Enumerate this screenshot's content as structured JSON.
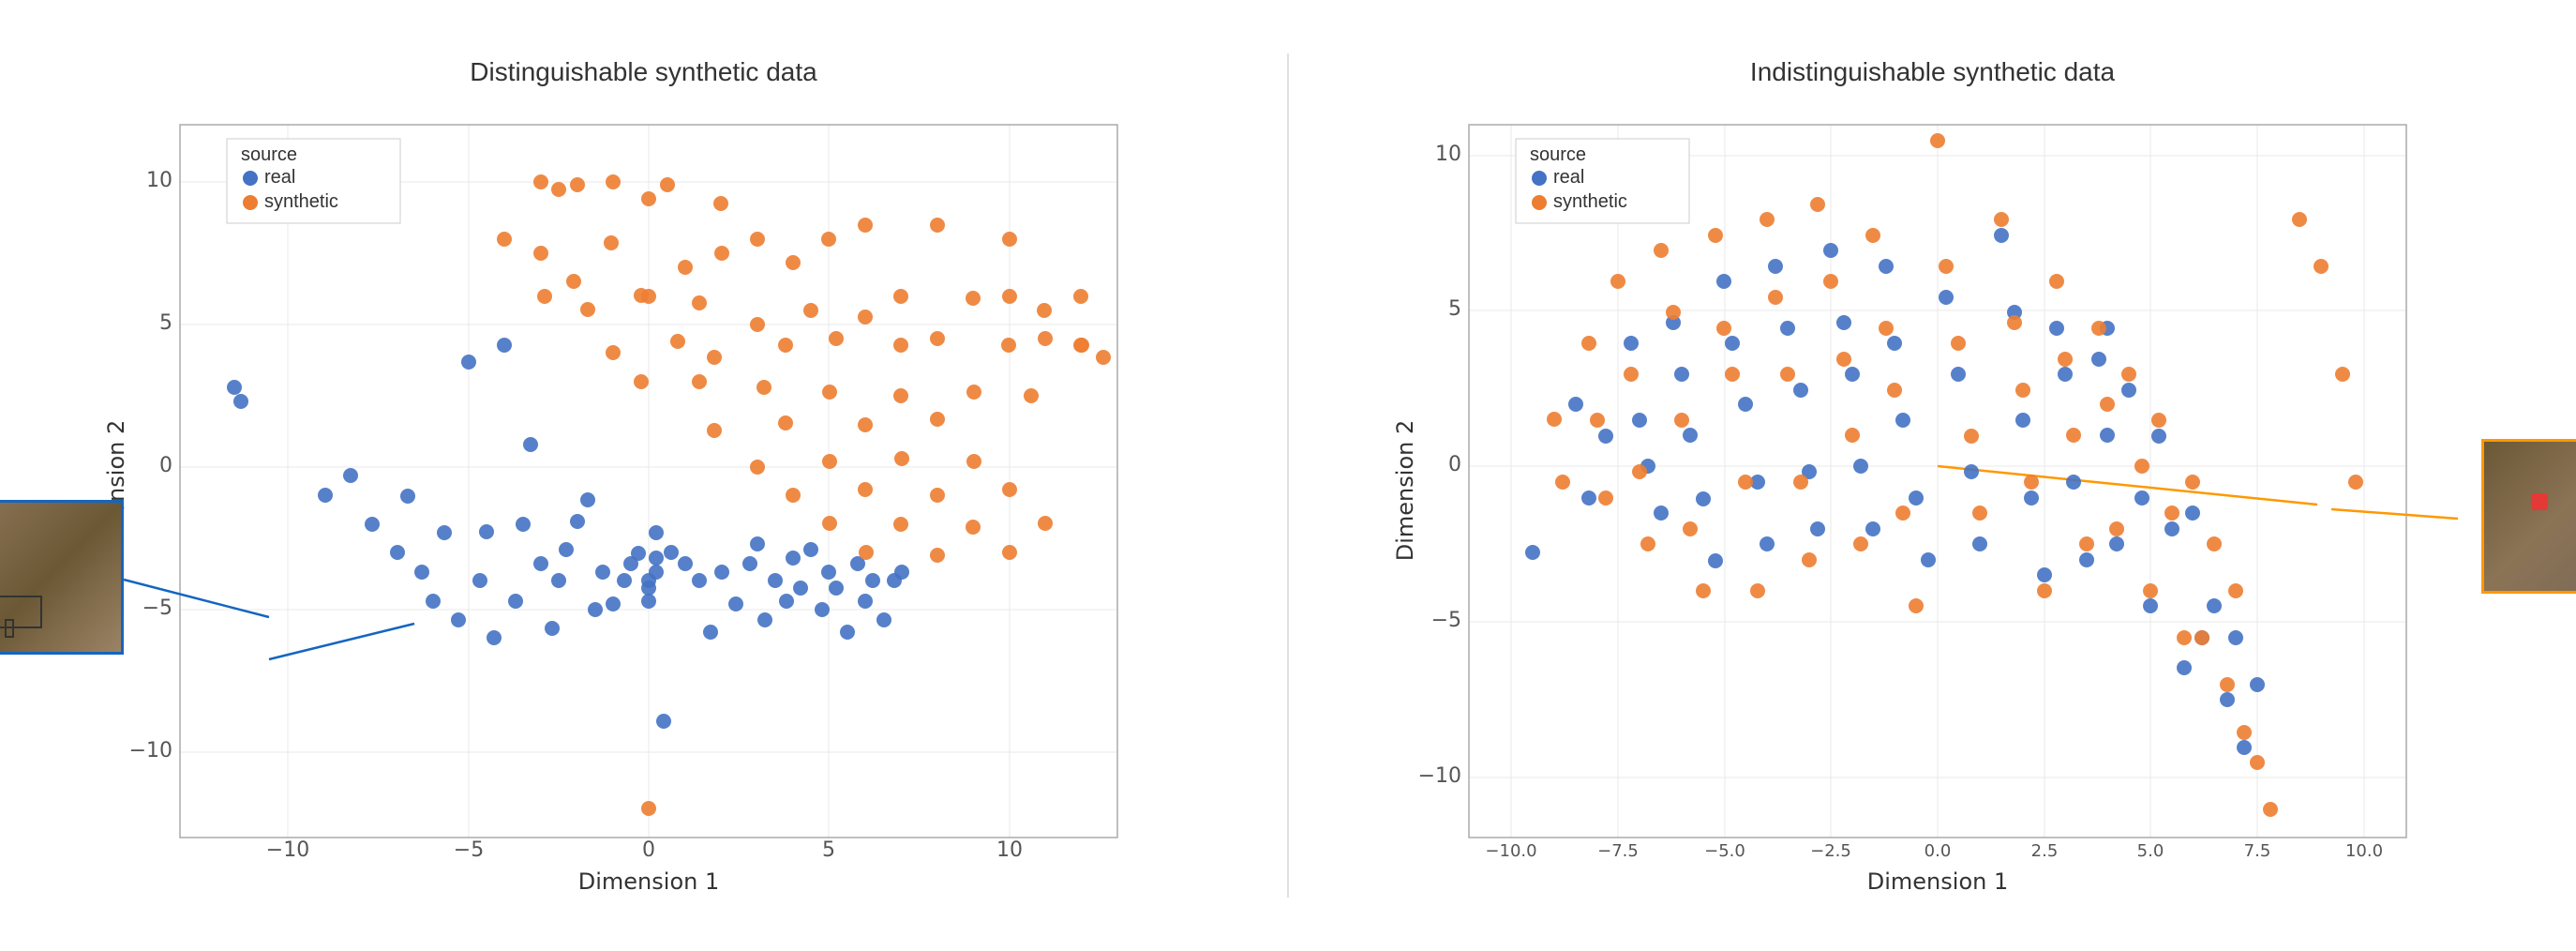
{
  "left_chart": {
    "title": "Distinguishable synthetic data",
    "x_label": "Dimension 1",
    "y_label": "Dimension 2",
    "legend": {
      "title": "source",
      "real_label": "real",
      "synthetic_label": "synthetic"
    },
    "x_ticks": [
      "-10",
      "-5",
      "0",
      "5",
      "10"
    ],
    "y_ticks": [
      "-10",
      "-5",
      "0",
      "5",
      "10"
    ],
    "real_points": [
      [
        -11.5,
        2.8
      ],
      [
        -11.3,
        2.3
      ],
      [
        -9.5,
        -1.5
      ],
      [
        -8.8,
        -0.8
      ],
      [
        -8.2,
        -2.5
      ],
      [
        -7.5,
        -3.8
      ],
      [
        -7.2,
        -1.2
      ],
      [
        -6.8,
        -4.5
      ],
      [
        -6.5,
        -5.5
      ],
      [
        -6.2,
        -2.8
      ],
      [
        -5.8,
        -6.2
      ],
      [
        -5.5,
        3.2
      ],
      [
        -5.2,
        -4.8
      ],
      [
        -5.0,
        -3.2
      ],
      [
        -4.8,
        -6.8
      ],
      [
        -4.5,
        3.8
      ],
      [
        -4.2,
        -5.5
      ],
      [
        -4.0,
        -2.5
      ],
      [
        -3.8,
        0.8
      ],
      [
        -3.5,
        -4.2
      ],
      [
        -3.2,
        -6.5
      ],
      [
        -3.0,
        -5.0
      ],
      [
        -2.8,
        -3.8
      ],
      [
        -2.5,
        -2.2
      ],
      [
        -2.2,
        -1.5
      ],
      [
        -2.0,
        -6.0
      ],
      [
        -1.8,
        -4.5
      ],
      [
        -1.5,
        -5.8
      ],
      [
        -1.2,
        -4.8
      ],
      [
        -1.0,
        -4.2
      ],
      [
        -0.8,
        -3.5
      ],
      [
        -0.5,
        -5.2
      ],
      [
        -0.3,
        -4.0
      ],
      [
        0.0,
        -4.8
      ],
      [
        0.2,
        -3.2
      ],
      [
        0.5,
        -5.5
      ],
      [
        0.8,
        -4.5
      ],
      [
        1.0,
        -9.5
      ],
      [
        1.2,
        -3.8
      ],
      [
        1.5,
        -4.2
      ],
      [
        1.8,
        -5.0
      ],
      [
        2.0,
        -6.8
      ],
      [
        2.2,
        -4.5
      ],
      [
        2.5,
        -5.8
      ],
      [
        2.8,
        -4.2
      ],
      [
        3.0,
        -3.5
      ],
      [
        3.2,
        -6.2
      ],
      [
        3.5,
        -4.8
      ],
      [
        3.8,
        -5.5
      ],
      [
        4.0,
        -4.0
      ],
      [
        4.2,
        -5.2
      ],
      [
        4.5,
        -3.8
      ],
      [
        4.8,
        -6.0
      ],
      [
        5.0,
        -4.5
      ],
      [
        5.2,
        -5.2
      ],
      [
        5.5,
        -6.8
      ],
      [
        5.8,
        -4.2
      ],
      [
        6.0,
        -5.5
      ],
      [
        6.2,
        -4.8
      ],
      [
        6.5,
        -6.2
      ],
      [
        6.8,
        -5.0
      ],
      [
        7.0,
        -4.5
      ]
    ],
    "synthetic_points": [
      [
        -3.0,
        10.0
      ],
      [
        -2.5,
        9.5
      ],
      [
        -1.8,
        9.8
      ],
      [
        -0.5,
        10.0
      ],
      [
        0.5,
        9.2
      ],
      [
        1.0,
        9.8
      ],
      [
        2.5,
        9.0
      ],
      [
        -4.5,
        8.0
      ],
      [
        -3.5,
        7.5
      ],
      [
        -2.0,
        6.5
      ],
      [
        -1.0,
        7.8
      ],
      [
        0.2,
        6.2
      ],
      [
        1.5,
        7.0
      ],
      [
        2.8,
        7.5
      ],
      [
        3.5,
        8.0
      ],
      [
        4.0,
        7.2
      ],
      [
        5.0,
        7.8
      ],
      [
        6.0,
        8.0
      ],
      [
        7.5,
        8.0
      ],
      [
        9.0,
        7.5
      ],
      [
        -2.8,
        5.8
      ],
      [
        -1.5,
        5.2
      ],
      [
        0.5,
        5.8
      ],
      [
        1.8,
        5.5
      ],
      [
        3.0,
        5.0
      ],
      [
        4.5,
        5.5
      ],
      [
        5.5,
        5.2
      ],
      [
        6.5,
        6.0
      ],
      [
        8.5,
        5.8
      ],
      [
        9.5,
        6.0
      ],
      [
        10.5,
        5.5
      ],
      [
        -1.2,
        3.8
      ],
      [
        0.8,
        4.2
      ],
      [
        2.2,
        3.5
      ],
      [
        3.8,
        4.0
      ],
      [
        5.2,
        4.5
      ],
      [
        6.8,
        4.0
      ],
      [
        8.0,
        4.2
      ],
      [
        9.8,
        4.0
      ],
      [
        11.0,
        4.2
      ],
      [
        11.5,
        4.0
      ],
      [
        12.0,
        3.5
      ],
      [
        0.2,
        2.5
      ],
      [
        1.8,
        2.2
      ],
      [
        3.5,
        2.8
      ],
      [
        5.0,
        2.5
      ],
      [
        7.0,
        2.8
      ],
      [
        9.0,
        2.2
      ],
      [
        10.5,
        2.0
      ],
      [
        2.0,
        1.2
      ],
      [
        4.2,
        1.8
      ],
      [
        6.5,
        1.5
      ],
      [
        8.5,
        1.2
      ],
      [
        3.0,
        0.2
      ],
      [
        5.5,
        0.5
      ],
      [
        7.5,
        0.8
      ],
      [
        9.5,
        0.5
      ],
      [
        4.0,
        -1.0
      ],
      [
        6.0,
        -0.8
      ],
      [
        8.0,
        -0.5
      ],
      [
        10.0,
        -0.8
      ],
      [
        4.5,
        -2.2
      ],
      [
        7.0,
        -2.0
      ],
      [
        9.0,
        -2.5
      ],
      [
        11.0,
        -2.2
      ],
      [
        6.0,
        -3.5
      ],
      [
        8.5,
        -3.8
      ],
      [
        10.5,
        -3.5
      ],
      [
        2.5,
        -12.5
      ]
    ]
  },
  "right_chart": {
    "title": "Indistinguishable synthetic data",
    "x_label": "Dimension 1",
    "y_label": "Dimension 2",
    "legend": {
      "title": "source",
      "real_label": "real",
      "synthetic_label": "synthetic"
    },
    "x_ticks": [
      "-10.0",
      "-7.5",
      "-5.0",
      "-2.5",
      "0.0",
      "2.5",
      "5.0",
      "7.5",
      "10.0"
    ],
    "y_ticks": [
      "-10",
      "-5",
      "0",
      "5",
      "10"
    ],
    "real_points": [
      [
        -9.5,
        -2.8
      ],
      [
        -8.5,
        2.0
      ],
      [
        -8.2,
        -1.5
      ],
      [
        -7.8,
        0.5
      ],
      [
        -7.2,
        3.5
      ],
      [
        -7.0,
        1.0
      ],
      [
        -6.8,
        -0.5
      ],
      [
        -6.5,
        -2.2
      ],
      [
        -6.2,
        4.2
      ],
      [
        -6.0,
        2.2
      ],
      [
        -5.8,
        0.2
      ],
      [
        -5.5,
        -1.8
      ],
      [
        -5.2,
        -3.5
      ],
      [
        -5.0,
        5.0
      ],
      [
        -4.8,
        3.0
      ],
      [
        -4.5,
        1.2
      ],
      [
        -4.2,
        -0.8
      ],
      [
        -4.0,
        -2.8
      ],
      [
        -3.8,
        5.5
      ],
      [
        -3.5,
        3.8
      ],
      [
        -3.2,
        1.5
      ],
      [
        -3.0,
        -0.2
      ],
      [
        -2.8,
        -2.5
      ],
      [
        -2.5,
        6.0
      ],
      [
        -2.2,
        4.2
      ],
      [
        -2.0,
        2.0
      ],
      [
        -1.8,
        -0.5
      ],
      [
        -1.5,
        -3.0
      ],
      [
        -1.2,
        5.5
      ],
      [
        -1.0,
        3.2
      ],
      [
        -0.8,
        1.0
      ],
      [
        -0.5,
        -1.5
      ],
      [
        -0.2,
        -4.0
      ],
      [
        0.2,
        4.5
      ],
      [
        0.5,
        2.2
      ],
      [
        0.8,
        -0.2
      ],
      [
        1.0,
        -3.2
      ],
      [
        1.5,
        5.8
      ],
      [
        1.8,
        3.5
      ],
      [
        2.0,
        1.0
      ],
      [
        2.2,
        -1.8
      ],
      [
        2.5,
        -4.5
      ],
      [
        2.8,
        4.0
      ],
      [
        3.0,
        1.5
      ],
      [
        3.2,
        -1.0
      ],
      [
        3.5,
        -4.0
      ],
      [
        3.8,
        2.8
      ],
      [
        4.0,
        0.2
      ],
      [
        4.2,
        -2.8
      ],
      [
        4.5,
        1.5
      ],
      [
        4.8,
        -1.5
      ],
      [
        5.0,
        -5.0
      ],
      [
        5.2,
        0.5
      ],
      [
        5.5,
        -2.5
      ],
      [
        5.8,
        -6.0
      ],
      [
        6.0,
        -1.2
      ],
      [
        6.2,
        -4.5
      ],
      [
        6.5,
        -2.8
      ],
      [
        6.8,
        -6.5
      ],
      [
        7.0,
        -4.0
      ],
      [
        7.2,
        -8.0
      ],
      [
        7.5,
        -5.5
      ],
      [
        4.0,
        4.0
      ]
    ],
    "synthetic_points": [
      [
        -9.0,
        1.5
      ],
      [
        -8.8,
        -0.8
      ],
      [
        -8.2,
        3.2
      ],
      [
        -8.0,
        0.8
      ],
      [
        -7.8,
        -1.8
      ],
      [
        -7.5,
        5.0
      ],
      [
        -7.2,
        2.5
      ],
      [
        -7.0,
        -0.2
      ],
      [
        -6.8,
        -2.8
      ],
      [
        -6.5,
        6.0
      ],
      [
        -6.2,
        3.5
      ],
      [
        -6.0,
        1.0
      ],
      [
        -5.8,
        -1.5
      ],
      [
        -5.5,
        -4.0
      ],
      [
        -5.2,
        6.5
      ],
      [
        -5.0,
        4.0
      ],
      [
        -4.8,
        1.8
      ],
      [
        -4.5,
        -0.8
      ],
      [
        -4.2,
        -3.5
      ],
      [
        -4.0,
        6.8
      ],
      [
        -3.8,
        4.5
      ],
      [
        -3.5,
        2.2
      ],
      [
        -3.2,
        -0.5
      ],
      [
        -3.0,
        -3.0
      ],
      [
        -2.8,
        7.0
      ],
      [
        -2.5,
        5.0
      ],
      [
        -2.2,
        2.8
      ],
      [
        -2.0,
        0.2
      ],
      [
        -1.8,
        -2.5
      ],
      [
        -1.5,
        6.2
      ],
      [
        -1.2,
        4.0
      ],
      [
        -1.0,
        1.5
      ],
      [
        -0.8,
        -1.2
      ],
      [
        -0.5,
        -3.8
      ],
      [
        0.0,
        10.2
      ],
      [
        0.2,
        5.5
      ],
      [
        0.5,
        3.0
      ],
      [
        0.8,
        0.5
      ],
      [
        1.0,
        -2.2
      ],
      [
        1.5,
        6.5
      ],
      [
        1.8,
        4.2
      ],
      [
        2.0,
        1.8
      ],
      [
        2.2,
        -0.8
      ],
      [
        2.5,
        -3.5
      ],
      [
        2.8,
        5.2
      ],
      [
        3.0,
        2.8
      ],
      [
        3.2,
        0.2
      ],
      [
        3.5,
        -2.8
      ],
      [
        3.8,
        3.8
      ],
      [
        4.0,
        1.2
      ],
      [
        4.2,
        -2.0
      ],
      [
        4.5,
        2.5
      ],
      [
        4.8,
        -0.5
      ],
      [
        5.0,
        -4.0
      ],
      [
        5.2,
        1.0
      ],
      [
        5.5,
        -1.8
      ],
      [
        5.8,
        -5.2
      ],
      [
        6.0,
        -0.5
      ],
      [
        6.2,
        -3.8
      ],
      [
        6.5,
        -2.0
      ],
      [
        6.8,
        -5.5
      ],
      [
        7.0,
        -3.5
      ],
      [
        7.2,
        -7.0
      ],
      [
        7.5,
        -9.5
      ],
      [
        7.8,
        -10.2
      ],
      [
        8.5,
        6.5
      ],
      [
        9.0,
        4.5
      ],
      [
        9.5,
        2.2
      ],
      [
        9.8,
        -0.5
      ]
    ]
  },
  "colors": {
    "real": "#4472C4",
    "synthetic": "#ED7D31",
    "background": "#ffffff",
    "axis": "#333333",
    "grid": "#e0e0e0",
    "thumbnail_border_left": "#1565C0",
    "thumbnail_border_right": "#FF9800"
  }
}
